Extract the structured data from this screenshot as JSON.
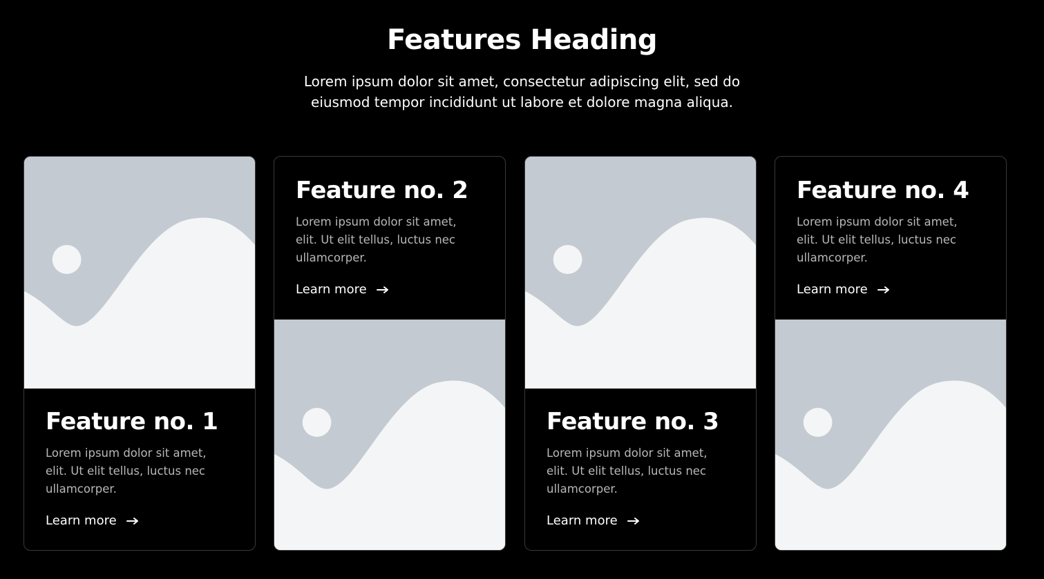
{
  "hero": {
    "title": "Features Heading",
    "subtitle": "Lorem ipsum dolor sit amet, consectetur adipiscing elit, sed do eiusmod tempor incididunt ut labore et dolore magna aliqua."
  },
  "colors": {
    "background": "#000000",
    "placeholder_bg": "#c4cad1",
    "placeholder_fg": "#f4f5f6",
    "muted_text": "#b8b8b8"
  },
  "cards": [
    {
      "title": "Feature no. 1",
      "description": "Lorem ipsum dolor sit amet,\nelit. Ut elit tellus, luctus nec\nullamcorper.",
      "link_label": "Learn more",
      "link_icon": "arrow-right-icon",
      "image_icon": "image-placeholder-icon"
    },
    {
      "title": "Feature no. 2",
      "description": "Lorem ipsum dolor sit amet,\nelit. Ut elit tellus, luctus nec\nullamcorper.",
      "link_label": "Learn more",
      "link_icon": "arrow-right-icon",
      "image_icon": "image-placeholder-icon"
    },
    {
      "title": "Feature no. 3",
      "description": "Lorem ipsum dolor sit amet,\nelit. Ut elit tellus, luctus nec\nullamcorper.",
      "link_label": "Learn more",
      "link_icon": "arrow-right-icon",
      "image_icon": "image-placeholder-icon"
    },
    {
      "title": "Feature no. 4",
      "description": "Lorem ipsum dolor sit amet,\nelit. Ut elit tellus, luctus nec\nullamcorper.",
      "link_label": "Learn more",
      "link_icon": "arrow-right-icon",
      "image_icon": "image-placeholder-icon"
    }
  ]
}
